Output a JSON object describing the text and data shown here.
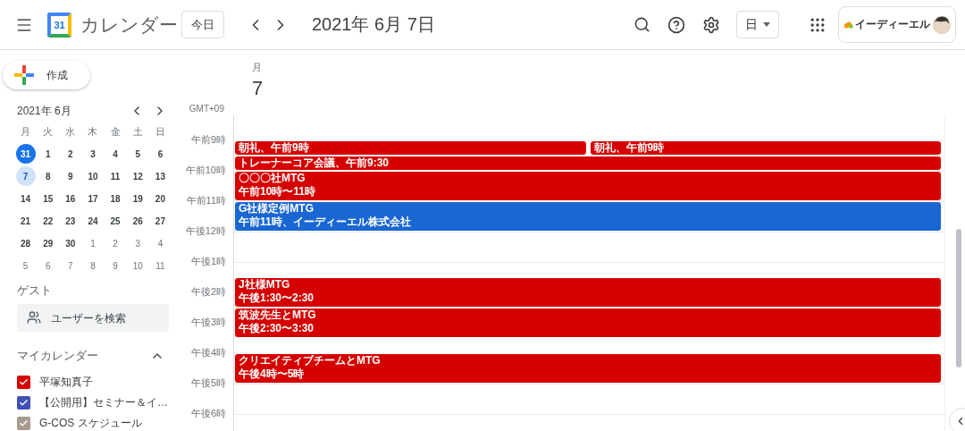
{
  "header": {
    "logo_text": "31",
    "app_name": "カレンダー",
    "today_button": "今日",
    "date_title": "2021年 6月 7日",
    "view_select": "日",
    "account": {
      "company": "イーディーエル"
    }
  },
  "create_button": "作成",
  "mini_calendar": {
    "title": "2021年 6月",
    "weekdays": [
      "月",
      "火",
      "水",
      "木",
      "金",
      "土",
      "日"
    ],
    "weeks": [
      [
        {
          "label": "31",
          "today": true,
          "selected": false,
          "muted": false
        },
        {
          "label": "1",
          "today": false,
          "selected": false,
          "muted": false
        },
        {
          "label": "2",
          "today": false,
          "selected": false,
          "muted": false
        },
        {
          "label": "3",
          "today": false,
          "selected": false,
          "muted": false
        },
        {
          "label": "4",
          "today": false,
          "selected": false,
          "muted": false
        },
        {
          "label": "5",
          "today": false,
          "selected": false,
          "muted": false
        },
        {
          "label": "6",
          "today": false,
          "selected": false,
          "muted": false
        }
      ],
      [
        {
          "label": "7",
          "today": false,
          "selected": true,
          "muted": false
        },
        {
          "label": "8",
          "today": false,
          "selected": false,
          "muted": false
        },
        {
          "label": "9",
          "today": false,
          "selected": false,
          "muted": false
        },
        {
          "label": "10",
          "today": false,
          "selected": false,
          "muted": false
        },
        {
          "label": "11",
          "today": false,
          "selected": false,
          "muted": false
        },
        {
          "label": "12",
          "today": false,
          "selected": false,
          "muted": false
        },
        {
          "label": "13",
          "today": false,
          "selected": false,
          "muted": false
        }
      ],
      [
        {
          "label": "14",
          "today": false,
          "selected": false,
          "muted": false
        },
        {
          "label": "15",
          "today": false,
          "selected": false,
          "muted": false
        },
        {
          "label": "16",
          "today": false,
          "selected": false,
          "muted": false
        },
        {
          "label": "17",
          "today": false,
          "selected": false,
          "muted": false
        },
        {
          "label": "18",
          "today": false,
          "selected": false,
          "muted": false
        },
        {
          "label": "19",
          "today": false,
          "selected": false,
          "muted": false
        },
        {
          "label": "20",
          "today": false,
          "selected": false,
          "muted": false
        }
      ],
      [
        {
          "label": "21",
          "today": false,
          "selected": false,
          "muted": false
        },
        {
          "label": "22",
          "today": false,
          "selected": false,
          "muted": false
        },
        {
          "label": "23",
          "today": false,
          "selected": false,
          "muted": false
        },
        {
          "label": "24",
          "today": false,
          "selected": false,
          "muted": false
        },
        {
          "label": "25",
          "today": false,
          "selected": false,
          "muted": false
        },
        {
          "label": "26",
          "today": false,
          "selected": false,
          "muted": false
        },
        {
          "label": "27",
          "today": false,
          "selected": false,
          "muted": false
        }
      ],
      [
        {
          "label": "28",
          "today": false,
          "selected": false,
          "muted": false
        },
        {
          "label": "29",
          "today": false,
          "selected": false,
          "muted": false
        },
        {
          "label": "30",
          "today": false,
          "selected": false,
          "muted": false
        },
        {
          "label": "1",
          "today": false,
          "selected": false,
          "muted": true
        },
        {
          "label": "2",
          "today": false,
          "selected": false,
          "muted": true
        },
        {
          "label": "3",
          "today": false,
          "selected": false,
          "muted": true
        },
        {
          "label": "4",
          "today": false,
          "selected": false,
          "muted": true
        }
      ],
      [
        {
          "label": "5",
          "today": false,
          "selected": false,
          "muted": true
        },
        {
          "label": "6",
          "today": false,
          "selected": false,
          "muted": true
        },
        {
          "label": "7",
          "today": false,
          "selected": false,
          "muted": true
        },
        {
          "label": "8",
          "today": false,
          "selected": false,
          "muted": true
        },
        {
          "label": "9",
          "today": false,
          "selected": false,
          "muted": true
        },
        {
          "label": "10",
          "today": false,
          "selected": false,
          "muted": true
        },
        {
          "label": "11",
          "today": false,
          "selected": false,
          "muted": true
        }
      ]
    ]
  },
  "guests": {
    "title": "ゲスト",
    "search_placeholder": "ユーザーを検索"
  },
  "my_calendars": {
    "title": "マイカレンダー",
    "expanded": true,
    "items": [
      {
        "name": "平塚知真子",
        "checked": true,
        "color": "#d50000"
      },
      {
        "name": "【公開用】セミナー＆イ…",
        "checked": true,
        "color": "#3f51b5"
      },
      {
        "name": "G-COS スケジュール",
        "checked": true,
        "color": "#a79b8e"
      }
    ]
  },
  "day_header": {
    "weekday": "月",
    "date": "7",
    "timezone": "GMT+09"
  },
  "hours": [
    "午前9時",
    "午前10時",
    "午前11時",
    "午後12時",
    "午後1時",
    "午後2時",
    "午後3時",
    "午後4時",
    "午後5時",
    "午後6時"
  ],
  "events": [
    {
      "title": "朝礼、午前9時",
      "color": "#d50000"
    },
    {
      "title": "朝礼、午前9時",
      "color": "#d50000"
    },
    {
      "title": "トレーナーコア会議、午前9:30",
      "color": "#d50000"
    },
    {
      "title": "〇〇〇社MTG",
      "time": "午前10時〜11時",
      "color": "#d50000"
    },
    {
      "title": "G社様定例MTG",
      "time": "午前11時、イーディーエル株式会社",
      "color": "#1967d2"
    },
    {
      "title": "J社様MTG",
      "time": "午後1:30〜2:30",
      "color": "#d50000"
    },
    {
      "title": "筑波先生とMTG",
      "time": "午後2:30〜3:30",
      "color": "#d50000"
    },
    {
      "title": "クリエイティブチームとMTG",
      "time": "午後4時〜5時",
      "color": "#d50000"
    }
  ]
}
